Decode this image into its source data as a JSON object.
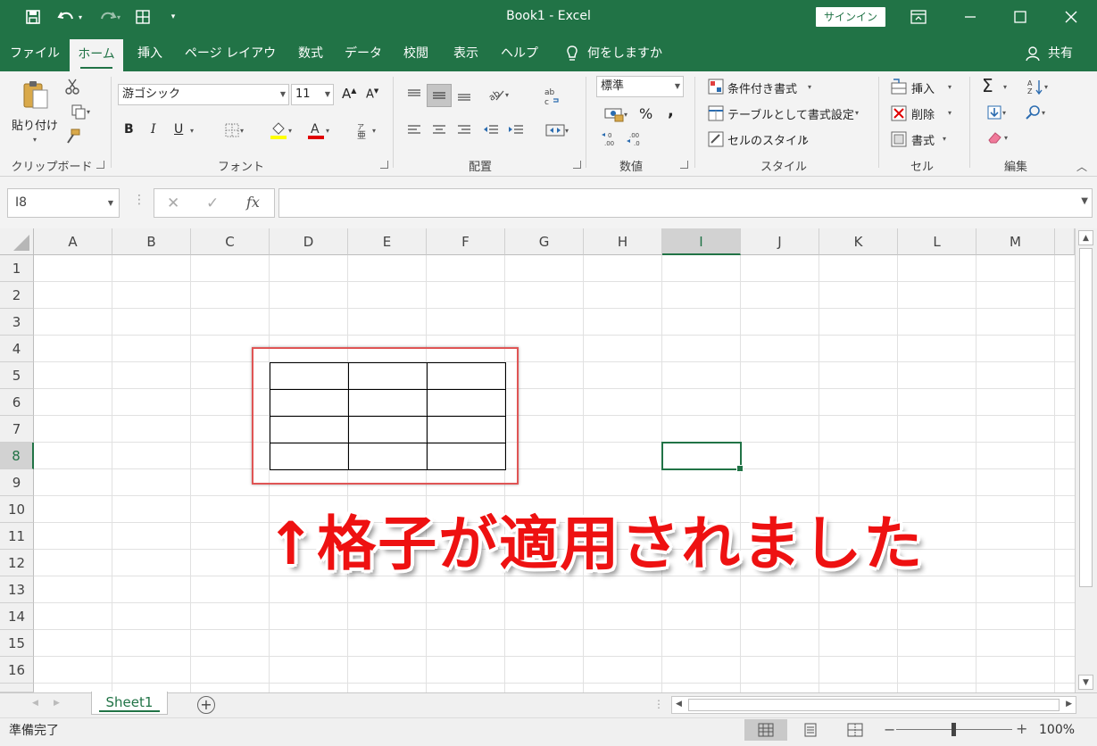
{
  "title_bar": {
    "title": "Book1  -  Excel",
    "signin_label": "サインイン",
    "icons": [
      "save-icon",
      "undo-icon",
      "redo-icon",
      "table-icon",
      "customize-icon",
      "ribbon-display-icon",
      "minimize-icon",
      "maximize-icon",
      "close-icon"
    ]
  },
  "tabs": {
    "items": [
      "ファイル",
      "ホーム",
      "挿入",
      "ページ レイアウト",
      "数式",
      "データ",
      "校閲",
      "表示",
      "ヘルプ"
    ],
    "active": "ホーム",
    "tell_me": "何をしますか",
    "share": "共有"
  },
  "ribbon": {
    "clipboard": {
      "paste_label": "貼り付け",
      "group_label": "クリップボード"
    },
    "font": {
      "font_name": "游ゴシック",
      "font_size": "11",
      "bold": "B",
      "italic": "I",
      "underline": "U",
      "group_label": "フォント"
    },
    "alignment": {
      "group_label": "配置"
    },
    "number": {
      "format": "標準",
      "percent": "%",
      "comma": ",",
      "group_label": "数値"
    },
    "styles": {
      "conditional": "条件付き書式",
      "as_table": "テーブルとして書式設定",
      "cell_styles": "セルのスタイル",
      "group_label": "スタイル"
    },
    "cells": {
      "insert": "挿入",
      "delete": "削除",
      "format": "書式",
      "group_label": "セル"
    },
    "editing": {
      "group_label": "編集"
    }
  },
  "formula_bar": {
    "name_box": "I8",
    "formula": "",
    "fx_label": "fx"
  },
  "grid": {
    "columns": [
      "A",
      "B",
      "C",
      "D",
      "E",
      "F",
      "G",
      "H",
      "I",
      "J",
      "K",
      "L",
      "M"
    ],
    "rows": [
      "1",
      "2",
      "3",
      "4",
      "5",
      "6",
      "7",
      "8",
      "9",
      "10",
      "11",
      "12",
      "13",
      "14",
      "15",
      "16"
    ],
    "selected_column": "I",
    "selected_row": "8",
    "bordered_range": "D5:F8"
  },
  "annotation": {
    "text": "↑格子が適用されました",
    "color": "#ee1111"
  },
  "sheets": {
    "items": [
      "Sheet1"
    ],
    "active": "Sheet1"
  },
  "status_bar": {
    "status": "準備完了",
    "zoom": "100%"
  },
  "colors": {
    "accent": "#217346",
    "annotation_box": "#e05555"
  }
}
